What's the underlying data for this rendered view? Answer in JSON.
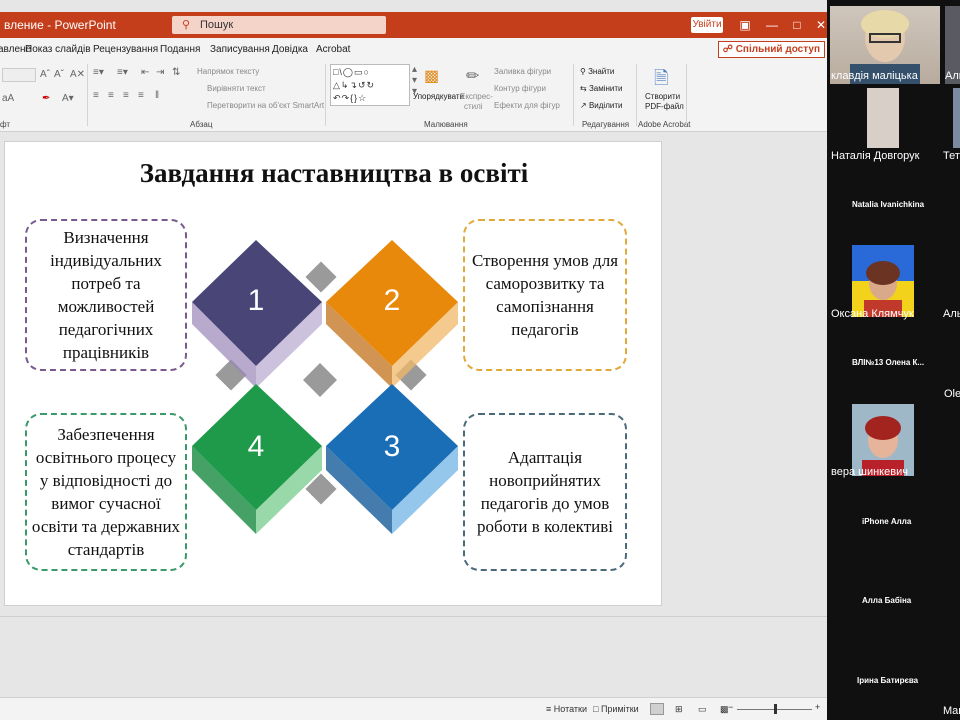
{
  "titlebar": {
    "doc_title": "вление  -  PowerPoint",
    "search_placeholder": "Пошук",
    "signin_label": "Увійти",
    "color": "#c43e1c"
  },
  "tabs": [
    {
      "label": "авлене"
    },
    {
      "label": "Показ слайдів"
    },
    {
      "label": "Рецензування"
    },
    {
      "label": "Подання"
    },
    {
      "label": "Записування"
    },
    {
      "label": "Довідка"
    },
    {
      "label": "Acrobat"
    }
  ],
  "share_label": "Спільний доступ",
  "ribbon": {
    "groups": {
      "font_partial": "фт",
      "paragraph": "Абзац",
      "drawing": "Малювання",
      "editing": "Редагування",
      "adobe": "Adobe Acrobat"
    },
    "paragraph_items": {
      "text_direction": "Напрямок тексту",
      "align_text": "Вирівняти текст",
      "smartart": "Перетворити на об'єкт SmartArt"
    },
    "drawing_items": {
      "arrange": "Упорядкувати",
      "quick_styles_1": "Експрес-",
      "quick_styles_2": "стилі",
      "shape_fill": "Заливка фігури",
      "shape_outline": "Контур фігури",
      "shape_effects": "Ефекти для фігур"
    },
    "editing_items": {
      "find": "Знайти",
      "replace": "Замінити",
      "select": "Виділити"
    },
    "adobe_items": {
      "create_1": "Створити",
      "create_2": "PDF-файл"
    }
  },
  "slide": {
    "title": "Завдання наставництва в освіті",
    "boxes": [
      {
        "text": "Визначення індивідуальних потреб та можливостей педагогічних працівників",
        "color": "#7a5a8e"
      },
      {
        "text": "Створення умов для саморозвитку та самопізнання педагогів",
        "color": "#e0a93a"
      },
      {
        "text": "Забезпечення освітнього процесу у відповідності до вимог сучасної освіти та державних стандартів",
        "color": "#3a9a6a"
      },
      {
        "text": "Адаптація новоприйнятих педагогів до умов роботи в колективі",
        "color": "#4a6a7a"
      }
    ],
    "tiles": [
      {
        "number": "1",
        "color": "#4a4577"
      },
      {
        "number": "2",
        "color": "#e8890c"
      },
      {
        "number": "3",
        "color": "#1a6eb5"
      },
      {
        "number": "4",
        "color": "#1f9a4a"
      }
    ]
  },
  "statusbar": {
    "notes": "Нотатки",
    "comments": "Примітки"
  },
  "participants": [
    {
      "name": "клавдія маліцька"
    },
    {
      "name": "Аль"
    },
    {
      "name": "Наталія Довгорук"
    },
    {
      "name": "Тетя"
    },
    {
      "name": "Natalia Ivanichkina"
    },
    {
      "name": "Оксана Клямчук"
    },
    {
      "name": "Аль"
    },
    {
      "name": "ВЛІ№13 Олена К..."
    },
    {
      "name": "Oleg"
    },
    {
      "name": "вера шинкевич"
    },
    {
      "name": "iPhone Алла"
    },
    {
      "name": "Алла Бабіна"
    },
    {
      "name": "Ірина Батирєва"
    },
    {
      "name": "Mar"
    }
  ]
}
